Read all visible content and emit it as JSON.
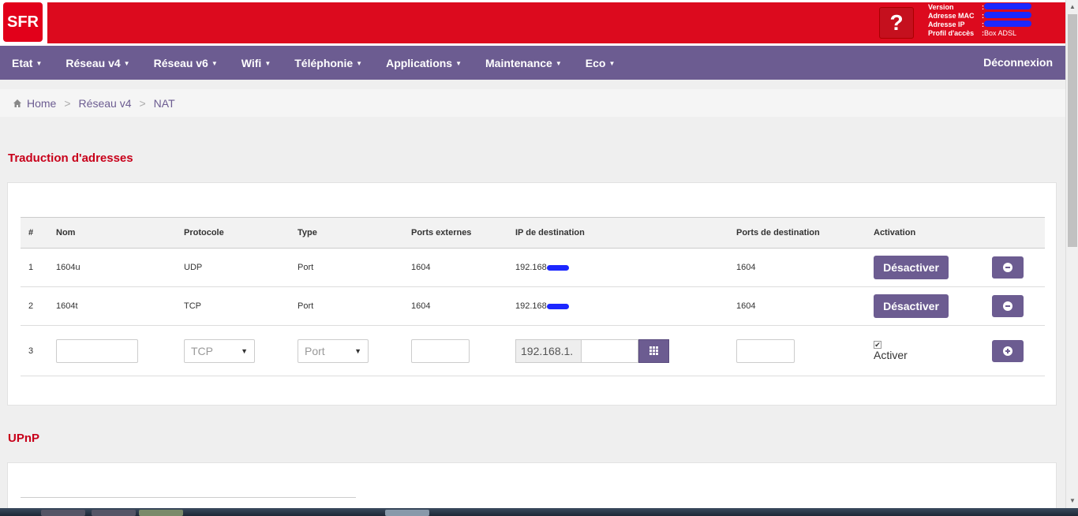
{
  "header": {
    "logo": "SFR",
    "help": "?",
    "info": [
      {
        "key": "Version",
        "value": ""
      },
      {
        "key": "Adresse MAC",
        "value": ""
      },
      {
        "key": "Adresse IP",
        "value": ""
      },
      {
        "key": "Profil d'accès",
        "value": "Box ADSL"
      }
    ]
  },
  "nav": {
    "items": [
      "Etat",
      "Réseau v4",
      "Réseau v6",
      "Wifi",
      "Téléphonie",
      "Applications",
      "Maintenance",
      "Eco"
    ],
    "logout": "Déconnexion"
  },
  "breadcrumb": {
    "home": "Home",
    "level1": "Réseau v4",
    "current": "NAT",
    "sep": ">"
  },
  "sections": {
    "nat": "Traduction d'adresses",
    "upnp": "UPnP"
  },
  "table": {
    "headers": [
      "#",
      "Nom",
      "Protocole",
      "Type",
      "Ports externes",
      "IP de destination",
      "Ports de destination",
      "Activation"
    ],
    "rows": [
      {
        "n": "1",
        "nom": "1604u",
        "protocole": "UDP",
        "type": "Port",
        "ext": "1604",
        "ip": "192.168",
        "dest": "1604",
        "action": "Désactiver"
      },
      {
        "n": "2",
        "nom": "1604t",
        "protocole": "TCP",
        "type": "Port",
        "ext": "1604",
        "ip": "192.168",
        "dest": "1604",
        "action": "Désactiver"
      }
    ],
    "new_row": {
      "n": "3",
      "protocole": "TCP",
      "type": "Port",
      "ip_prefix": "192.168.1.",
      "activer": "Activer"
    }
  },
  "colors": {
    "accent": "#6c5c91",
    "brand_red": "#dc0a1e",
    "title_red": "#c8001a"
  }
}
